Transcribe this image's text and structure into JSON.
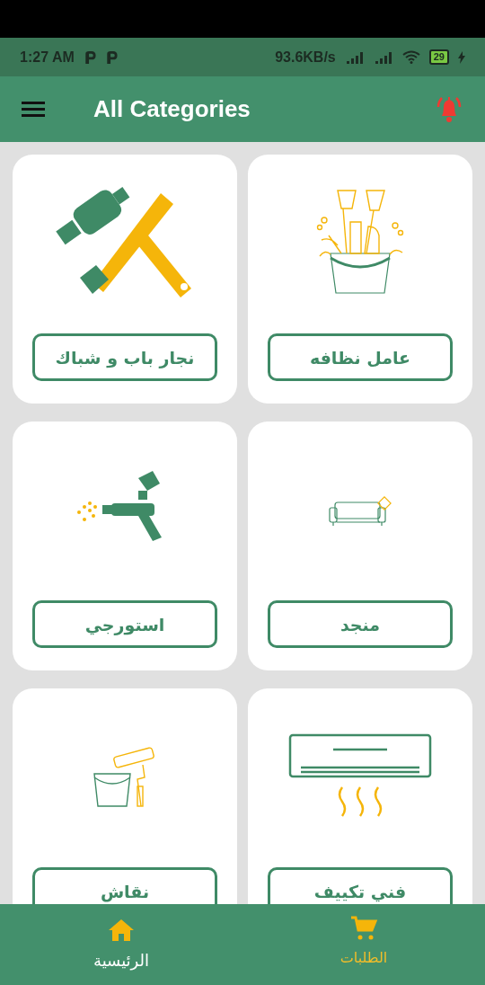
{
  "status_bar": {
    "time": "1:27 AM",
    "speed": "93.6KB/s",
    "battery": "29"
  },
  "app_bar": {
    "title": "All Categories"
  },
  "categories": [
    {
      "label": "عامل نظافه"
    },
    {
      "label": "نجار باب و شباك"
    },
    {
      "label": "منجد"
    },
    {
      "label": "استورجي"
    },
    {
      "label": "فني تكييف"
    },
    {
      "label": "نقاش"
    }
  ],
  "bottom_nav": [
    {
      "label": "الطلبات",
      "selected": false
    },
    {
      "label": "الرئيسية",
      "selected": true
    }
  ]
}
